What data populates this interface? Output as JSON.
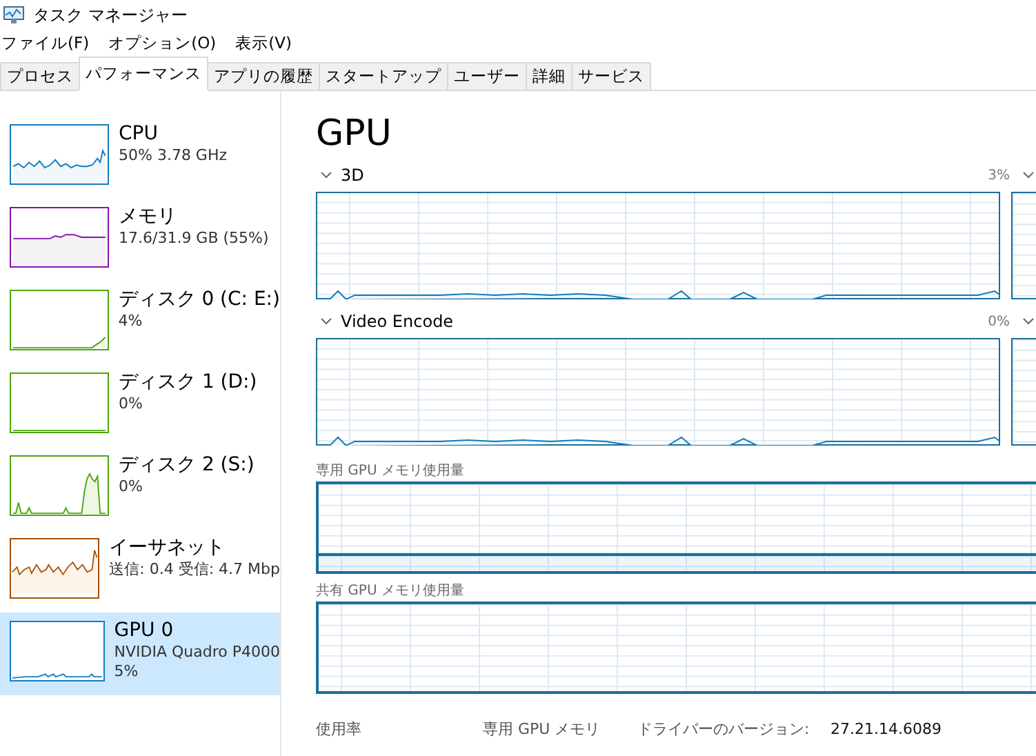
{
  "window": {
    "title": "タスク マネージャー"
  },
  "menu": [
    "ファイル(F)",
    "オプション(O)",
    "表示(V)"
  ],
  "tabs": [
    {
      "label": "プロセス",
      "selected": false
    },
    {
      "label": "パフォーマンス",
      "selected": true
    },
    {
      "label": "アプリの履歴",
      "selected": false
    },
    {
      "label": "スタートアップ",
      "selected": false
    },
    {
      "label": "ユーザー",
      "selected": false
    },
    {
      "label": "詳細",
      "selected": false
    },
    {
      "label": "サービス",
      "selected": false
    }
  ],
  "sidebar": {
    "items": [
      {
        "kind": "cpu",
        "name": "CPU",
        "details": [
          "50%  3.78 GHz"
        ],
        "color": "#117dbb",
        "selected": false
      },
      {
        "kind": "memory",
        "name": "メモリ",
        "details": [
          "17.6/31.9 GB (55%)"
        ],
        "color": "#8b12ae",
        "selected": false
      },
      {
        "kind": "disk",
        "name": "ディスク 0 (C: E:)",
        "details": [
          "4%"
        ],
        "color": "#4da60c",
        "selected": false
      },
      {
        "kind": "disk",
        "name": "ディスク 1 (D:)",
        "details": [
          "0%"
        ],
        "color": "#4da60c",
        "selected": false
      },
      {
        "kind": "disk",
        "name": "ディスク 2 (S:)",
        "details": [
          "0%"
        ],
        "color": "#4da60c",
        "selected": false
      },
      {
        "kind": "ethernet",
        "name": "イーサネット",
        "details": [
          "送信: 0.4 受信: 4.7 Mbp"
        ],
        "color": "#a74f01",
        "selected": false
      },
      {
        "kind": "gpu",
        "name": "GPU 0",
        "details": [
          "NVIDIA Quadro P4000",
          "5%"
        ],
        "color": "#117dbb",
        "selected": true
      }
    ]
  },
  "main": {
    "title": "GPU",
    "engines": [
      {
        "label": "3D",
        "reading": "3%"
      },
      {
        "label": "Video Encode",
        "reading": "0%"
      }
    ],
    "memory_graphs": [
      {
        "label": "専用 GPU メモリ使用量"
      },
      {
        "label": "共有 GPU メモリ使用量"
      }
    ],
    "stats": [
      {
        "label": "使用率"
      },
      {
        "label": "専用 GPU メモリ"
      },
      {
        "label": "ドライバーのバージョン:",
        "value": "27.21.14.6089"
      }
    ]
  }
}
